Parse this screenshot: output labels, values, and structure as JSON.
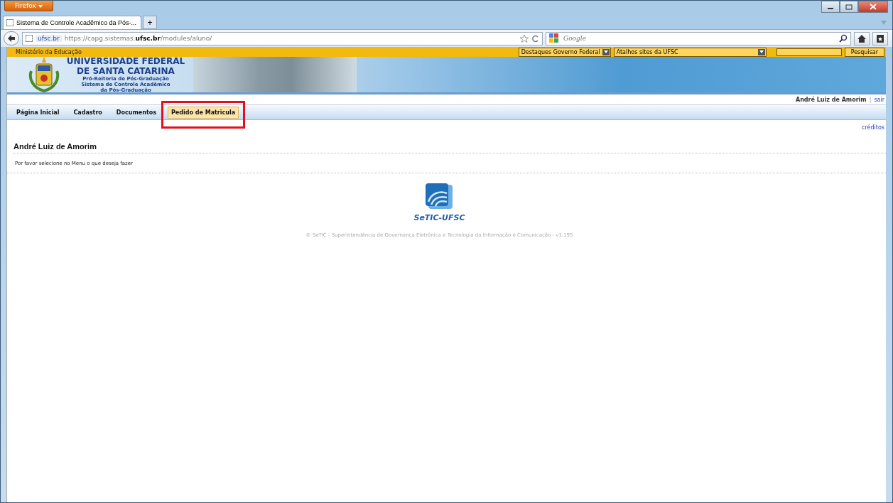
{
  "browser": {
    "app_button": "Firefox",
    "tabs": [
      {
        "title": "Sistema de Controle Acadêmico da Pós-...",
        "selected": true
      }
    ],
    "new_tab": "+",
    "url_domain": "ufsc.br",
    "url": "https://capg.sistemas.**ufsc.br**/modules/aluno/",
    "search_placeholder": "Google"
  },
  "gov_bar": {
    "label": "Ministério da Educação",
    "select_1": "Destaques Governo Federal",
    "select_2": "Atalhos sites da UFSC",
    "search_button": "Pesquisar"
  },
  "header": {
    "title_1": "UNIVERSIDADE FEDERAL",
    "title_2": "DE SANTA CATARINA",
    "subtitle_1": "Pró-Reitoria de Pós-Graduação",
    "subtitle_2": "Sistema de Controle Acadêmico",
    "subtitle_3": "da Pós-Graduação"
  },
  "user": {
    "name": "André Luiz de Amorim",
    "separator": "|",
    "logout": "sair"
  },
  "menu": [
    {
      "label": "Página Inicial",
      "selected": false
    },
    {
      "label": "Cadastro",
      "selected": false
    },
    {
      "label": "Documentos",
      "selected": false
    },
    {
      "label": "Pedido de Matricula",
      "selected": true
    }
  ],
  "credits": "créditos",
  "page_title": "André Luiz de Amorim",
  "message": "Por favor selecione no Menu o que deseja fazer",
  "footer": {
    "logo_text": "SeTIC-UFSC",
    "copyright": "© SeTIC - Superintendência de Governança Eletrônica e Tecnologia da Informação e Comunicação - v1.195"
  }
}
